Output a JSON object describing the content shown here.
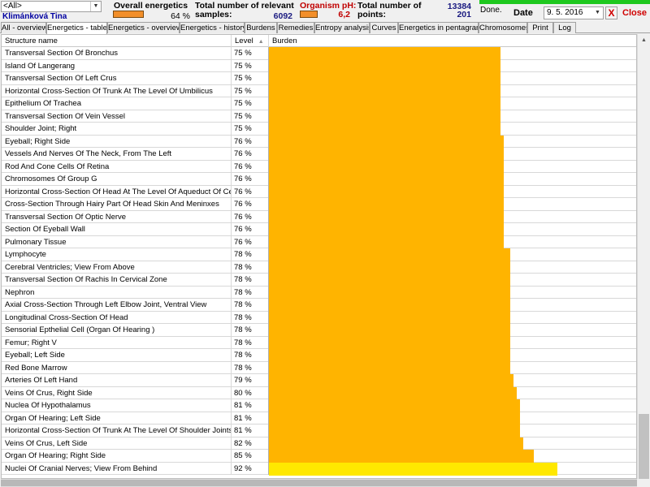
{
  "header": {
    "filter_value": "<All>",
    "patient_name": "Klimánková Tina",
    "overall_energetics_label": "Overall energetics",
    "overall_energetics_value": "64 %",
    "samples_label_line1": "Total number of relevant",
    "samples_label_line2": "samples:",
    "samples_value": "6092",
    "ph_label": "Organism pH:",
    "ph_value": "6,2",
    "points_label_line1": "Total number of",
    "points_label_line2": "points:",
    "points_value_top": "13384",
    "points_value_bottom": "201",
    "status": "Done.",
    "date_label": "Date",
    "date_value": "9. 5. 2016",
    "close_x": "X",
    "close_label": "Close"
  },
  "tabs": [
    {
      "label": "All - overview",
      "active": false
    },
    {
      "label": "Energetics - table",
      "active": true
    },
    {
      "label": "Energetics - overview",
      "active": false
    },
    {
      "label": "Energetics - history",
      "active": false
    },
    {
      "label": "Burdens",
      "active": false
    },
    {
      "label": "Remedies",
      "active": false
    },
    {
      "label": "Entropy analysis",
      "active": false
    },
    {
      "label": "Curves",
      "active": false
    },
    {
      "label": "Energetics in pentagram",
      "active": false
    },
    {
      "label": "Chromosomes",
      "active": false
    },
    {
      "label": "Print",
      "active": false
    },
    {
      "label": "Log",
      "active": false
    }
  ],
  "table": {
    "columns": {
      "name": "Structure name",
      "level": "Level",
      "burden": "Burden"
    },
    "rows": [
      {
        "name": "Transversal Section Of Bronchus",
        "level": "75 %",
        "value": 75
      },
      {
        "name": "Island Of Langerang",
        "level": "75 %",
        "value": 75
      },
      {
        "name": "Transversal Section Of Left Crus",
        "level": "75 %",
        "value": 75
      },
      {
        "name": "Horizontal Cross-Section Of Trunk At The Level Of Umbilicus",
        "level": "75 %",
        "value": 75
      },
      {
        "name": "Epithelium Of Trachea",
        "level": "75 %",
        "value": 75
      },
      {
        "name": "Transversal Section Of Vein Vessel",
        "level": "75 %",
        "value": 75
      },
      {
        "name": "Shoulder Joint; Right",
        "level": "75 %",
        "value": 75
      },
      {
        "name": "Eyeball; Right Side",
        "level": "76 %",
        "value": 76
      },
      {
        "name": "Vessels And Nerves Of The Neck, From The Left",
        "level": "76 %",
        "value": 76
      },
      {
        "name": "Rod And Cone Cells Of Retina",
        "level": "76 %",
        "value": 76
      },
      {
        "name": "Chromosomes Of Group G",
        "level": "76 %",
        "value": 76
      },
      {
        "name": "Horizontal Cross-Section Of Head At The Level Of Aqueduct Of Cerebrum",
        "level": "76 %",
        "value": 76
      },
      {
        "name": "Cross-Section Through Hairy Part Of Head Skin And Meninxes",
        "level": "76 %",
        "value": 76
      },
      {
        "name": "Transversal Section Of Optic Nerve",
        "level": "76 %",
        "value": 76
      },
      {
        "name": "Section Of Eyeball Wall",
        "level": "76 %",
        "value": 76
      },
      {
        "name": "Pulmonary Tissue",
        "level": "76 %",
        "value": 76
      },
      {
        "name": "Lymphocyte",
        "level": "78 %",
        "value": 78
      },
      {
        "name": "Cerebral Ventricles; View From Above",
        "level": "78 %",
        "value": 78
      },
      {
        "name": "Transversal Section Of Rachis In Cervical Zone",
        "level": "78 %",
        "value": 78
      },
      {
        "name": "Nephron",
        "level": "78 %",
        "value": 78
      },
      {
        "name": "Axial Cross-Section Through Left Elbow Joint, Ventral View",
        "level": "78 %",
        "value": 78
      },
      {
        "name": "Longitudinal Cross-Section Of Head",
        "level": "78 %",
        "value": 78
      },
      {
        "name": "Sensorial Epthelial Cell (Organ Of Hearing )",
        "level": "78 %",
        "value": 78
      },
      {
        "name": "Femur; Right V",
        "level": "78 %",
        "value": 78
      },
      {
        "name": "Eyeball; Left Side",
        "level": "78 %",
        "value": 78
      },
      {
        "name": "Red Bone Marrow",
        "level": "78 %",
        "value": 78
      },
      {
        "name": "Arteries Of Left Hand",
        "level": "79 %",
        "value": 79
      },
      {
        "name": "Veins Of Crus, Right Side",
        "level": "80 %",
        "value": 80
      },
      {
        "name": "Nuclea Of Hypothalamus",
        "level": "81 %",
        "value": 81
      },
      {
        "name": "Organ Of Hearing; Left Side",
        "level": "81 %",
        "value": 81
      },
      {
        "name": "Horizontal Cross-Section Of Trunk At The Level Of Shoulder Joints",
        "level": "81 %",
        "value": 81
      },
      {
        "name": "Veins Of Crus, Left Side",
        "level": "82 %",
        "value": 82
      },
      {
        "name": "Organ Of Hearing; Right Side",
        "level": "85 %",
        "value": 85
      },
      {
        "name": "Nuclei Of Cranial Nerves; View From Behind",
        "level": "92 %",
        "value": 92
      }
    ]
  },
  "colors": {
    "bar_orange": "#ffb400",
    "bar_yellow": "#ffe800",
    "swatch": "#f28f2a",
    "progress_green": "#1ec81e",
    "close_red": "#d00000",
    "ph_red": "#c00000"
  },
  "icons": {
    "combo_arrow": "chevron-down-icon",
    "sort_arrow": "sort-up-icon",
    "scroll_up": "arrow-up-icon",
    "close": "close-icon"
  }
}
